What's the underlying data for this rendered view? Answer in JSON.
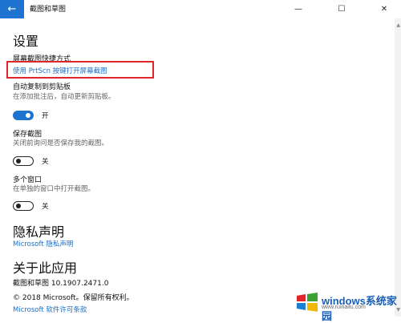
{
  "window": {
    "title": "截图和草图",
    "back_glyph": "←",
    "minimize_glyph": "—",
    "maximize_glyph": "☐",
    "close_glyph": "✕"
  },
  "settings": {
    "heading": "设置",
    "shortcut": {
      "label": "屏幕截图快捷方式",
      "link": "使用 PrtScn 按键打开屏幕截图"
    },
    "auto_copy": {
      "label": "自动复制到剪贴板",
      "desc": "在添加批注后，自动更新剪贴板。",
      "state": "开",
      "on": true
    },
    "save_snip": {
      "label": "保存截图",
      "desc": "关闭前询问是否保存我的截图。",
      "state": "关",
      "on": false
    },
    "multi_window": {
      "label": "多个窗口",
      "desc": "在单独的窗口中打开截图。",
      "state": "关",
      "on": false
    }
  },
  "privacy": {
    "heading": "隐私声明",
    "link": "Microsoft 隐私声明"
  },
  "about": {
    "heading": "关于此应用",
    "version": "截图和草图 10.1907.2471.0",
    "copyright": "© 2018 Microsoft。保留所有权利。",
    "license_link": "Microsoft 软件许可条款"
  },
  "watermark": {
    "brand": "windows系统家园",
    "url": "www.ruinaitu.com",
    "colors": {
      "blue": "#1a5fb4",
      "red": "#e0262c"
    }
  }
}
